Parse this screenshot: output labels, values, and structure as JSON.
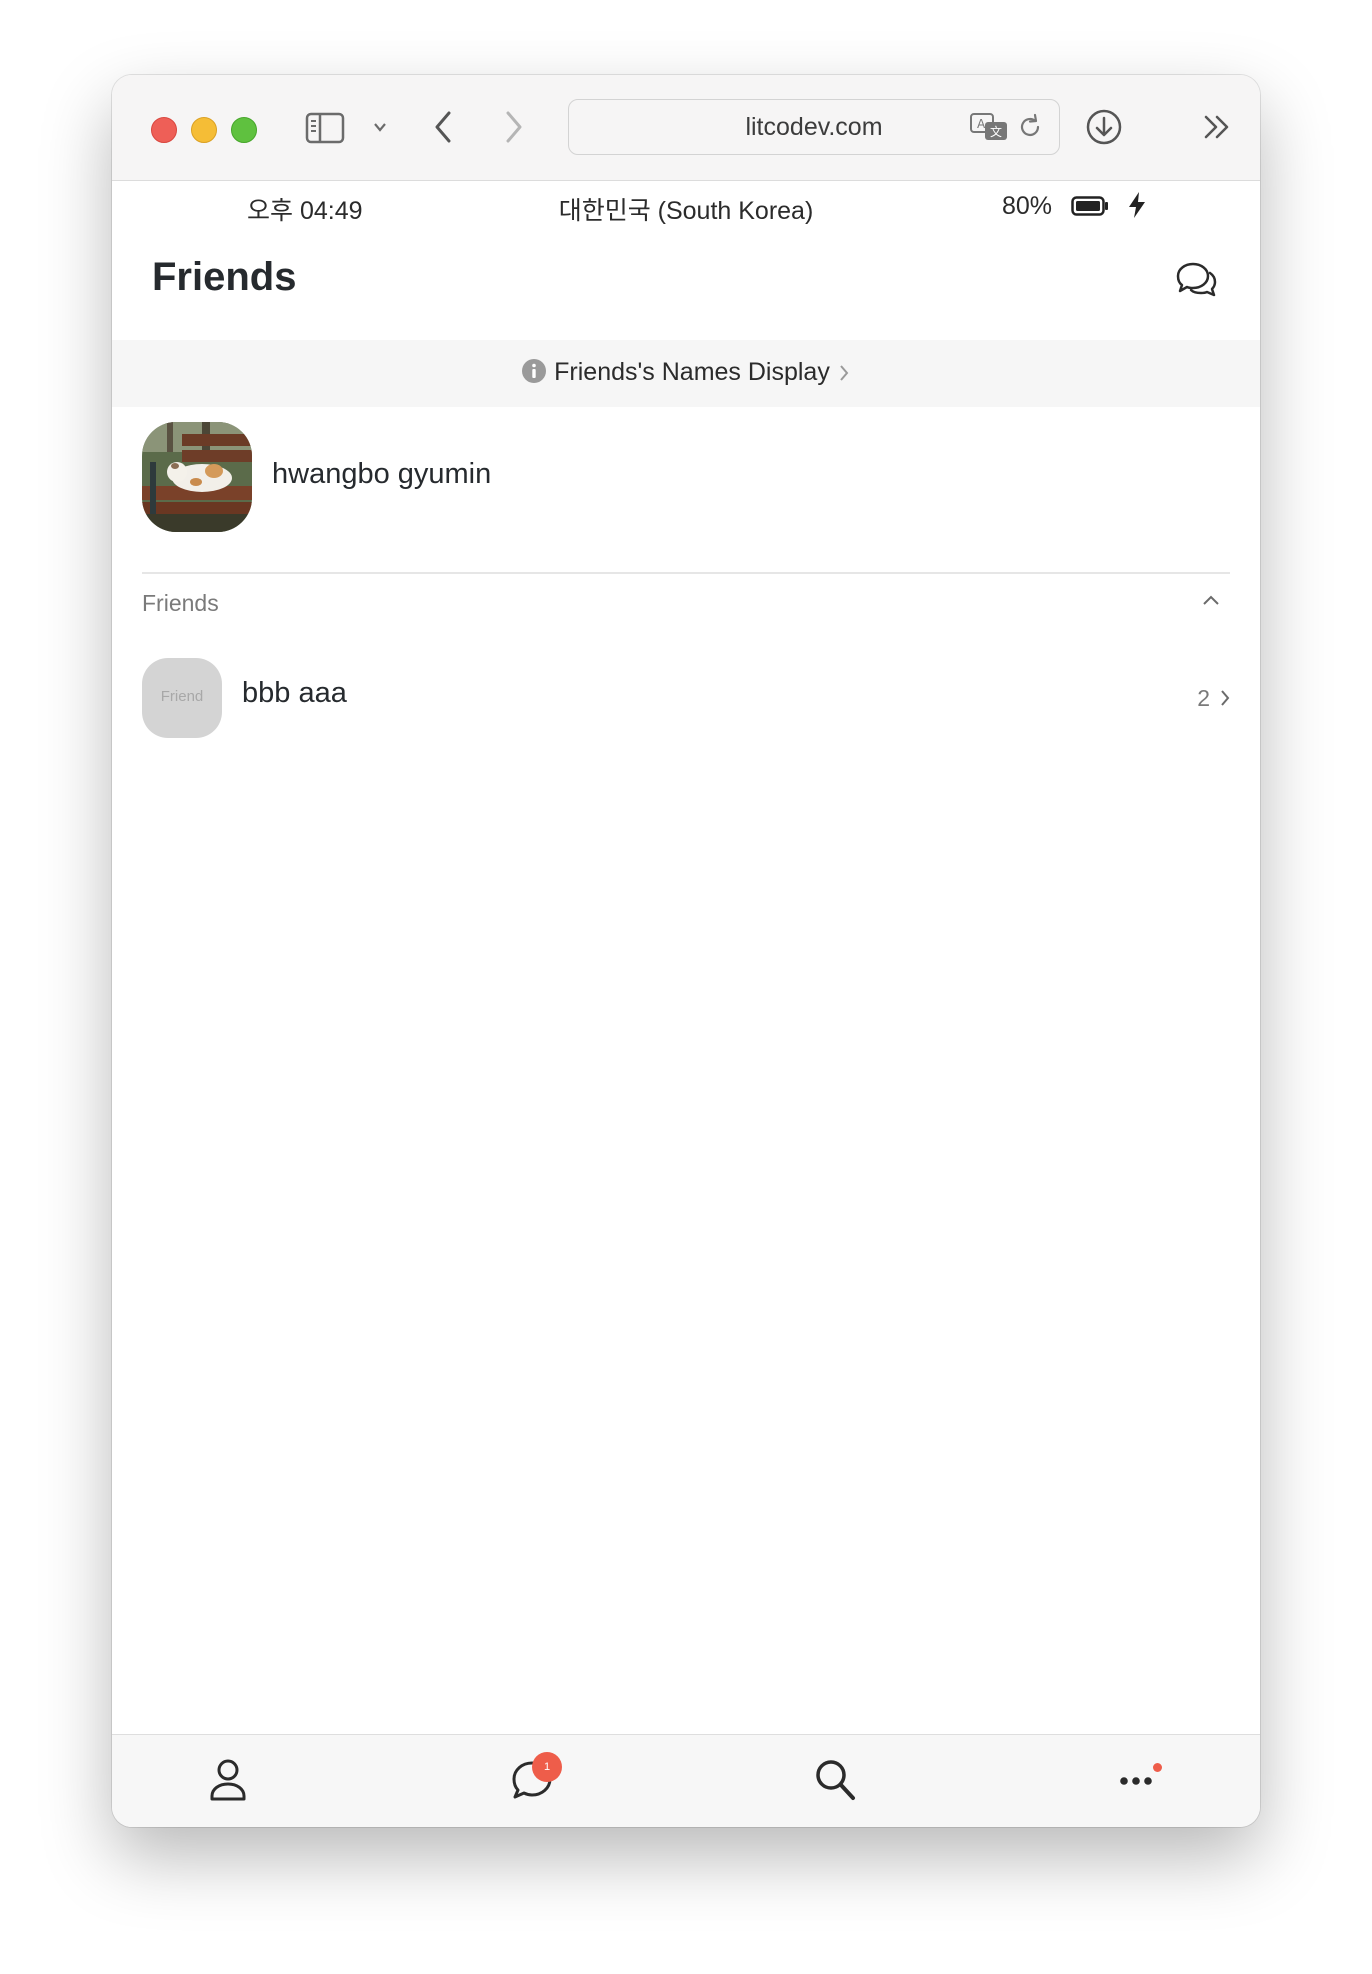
{
  "browser": {
    "url": "litcodev.com"
  },
  "status_bar": {
    "time": "오후 04:49",
    "region": "대한민국 (South Korea)",
    "battery": "80%"
  },
  "header": {
    "title": "Friends"
  },
  "banner": {
    "text": "Friends's Names Display"
  },
  "profile": {
    "name": "hwangbo gyumin"
  },
  "friends_section": {
    "title": "Friends",
    "items": [
      {
        "avatar_label": "Friend",
        "name": "bbb aaa",
        "count": "2"
      }
    ]
  },
  "bottom_nav": {
    "chat_badge": "1",
    "icons": [
      "person-icon",
      "chat-icon",
      "search-icon",
      "more-icon"
    ]
  },
  "colors": {
    "accent": "#ee5d4a",
    "text": "#262a2e",
    "muted": "#7a7a7a"
  }
}
